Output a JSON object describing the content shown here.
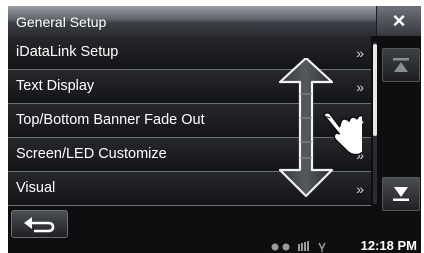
{
  "header": {
    "title": "General Setup",
    "close_icon": "close-x-icon"
  },
  "menu": {
    "items": [
      {
        "label": "iDataLink Setup",
        "chevron": "»"
      },
      {
        "label": "Text Display",
        "chevron": "»"
      },
      {
        "label": "Top/Bottom Banner Fade Out",
        "chevron": "»"
      },
      {
        "label": "Screen/LED Customize",
        "chevron": "»"
      },
      {
        "label": "Visual",
        "chevron": "»"
      }
    ]
  },
  "nav": {
    "page_up_icon": "page-up-icon",
    "page_down_icon": "page-down-icon",
    "back_icon": "back-arrow-icon"
  },
  "status": {
    "time": "12:18 PM"
  },
  "colors": {
    "background": "#0e0e10",
    "accent": "#ffffff",
    "divider": "#6d7075"
  }
}
